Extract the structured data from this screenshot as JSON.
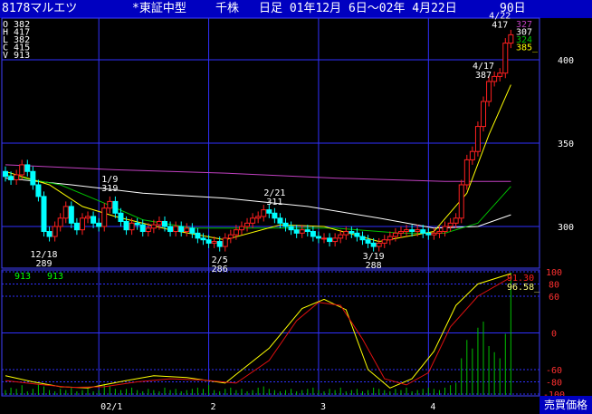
{
  "header": {
    "code_name": "8178マルエツ",
    "market": "*東証中型",
    "board": "千株",
    "period": "日足 01年12月 6日～02年 4月22日",
    "days": "90日"
  },
  "ohlcv": {
    "O": "382",
    "H": "417",
    "L": "382",
    "C": "415",
    "V": "913"
  },
  "ma_values": [
    {
      "value": "327",
      "color": "#c040c0"
    },
    {
      "value": "307",
      "color": "#ffffff"
    },
    {
      "value": "324",
      "color": "#00c000"
    },
    {
      "value": "385_",
      "color": "#ffff00"
    }
  ],
  "volume_label": {
    "a": "913",
    "b": "913"
  },
  "osc_values": [
    {
      "value": "91.30",
      "color": "#ff2020"
    },
    {
      "value": "96.58_",
      "color": "#ffff80"
    }
  ],
  "button_label": "売買価格",
  "chart_data": {
    "type": "candlestick",
    "price_axis": {
      "ticks": [
        300,
        350,
        400
      ],
      "ylim": [
        275,
        425
      ]
    },
    "osc_axis": {
      "ticks": [
        100,
        80,
        60,
        0,
        -60,
        -80,
        -100
      ],
      "ylim": [
        -100,
        100
      ]
    },
    "x_labels": [
      {
        "label": "02/1",
        "index": 17
      },
      {
        "label": "2",
        "index": 37
      },
      {
        "label": "3",
        "index": 57
      },
      {
        "label": "4",
        "index": 77
      }
    ],
    "annotations": [
      {
        "date": "12/18",
        "value": "289",
        "index": 7,
        "pos": "below"
      },
      {
        "date": "1/9",
        "value": "319",
        "index": 19,
        "pos": "above"
      },
      {
        "date": "2/5",
        "value": "286",
        "index": 39,
        "pos": "below"
      },
      {
        "date": "2/21",
        "value": "311",
        "index": 49,
        "pos": "above"
      },
      {
        "date": "3/19",
        "value": "288",
        "index": 67,
        "pos": "below"
      },
      {
        "date": "4/17",
        "value": "387",
        "index": 87,
        "pos": "above"
      },
      {
        "date": "4/22",
        "value": "417",
        "index": 90,
        "pos": "above"
      }
    ],
    "closes": [
      330,
      328,
      331,
      337,
      333,
      325,
      318,
      297,
      294,
      300,
      305,
      312,
      302,
      298,
      305,
      306,
      302,
      300,
      311,
      315,
      308,
      303,
      298,
      302,
      301,
      297,
      299,
      301,
      303,
      300,
      297,
      300,
      297,
      299,
      296,
      293,
      292,
      290,
      291,
      288,
      293,
      295,
      298,
      300,
      302,
      305,
      306,
      310,
      308,
      305,
      302,
      300,
      298,
      296,
      298,
      297,
      294,
      293,
      293,
      291,
      293,
      295,
      297,
      296,
      294,
      292,
      290,
      288,
      290,
      292,
      294,
      296,
      297,
      298,
      297,
      298,
      296,
      295,
      296,
      297,
      300,
      302,
      305,
      325,
      340,
      345,
      360,
      375,
      387,
      390,
      392,
      410,
      415
    ],
    "ma_series": [
      {
        "color": "#c040c0",
        "points": [
          [
            0,
            337
          ],
          [
            20,
            334
          ],
          [
            40,
            332
          ],
          [
            60,
            329
          ],
          [
            80,
            327
          ],
          [
            92,
            327
          ]
        ]
      },
      {
        "color": "#ffffff",
        "points": [
          [
            0,
            329
          ],
          [
            12,
            325
          ],
          [
            25,
            320
          ],
          [
            40,
            317
          ],
          [
            55,
            312
          ],
          [
            68,
            305
          ],
          [
            78,
            299
          ],
          [
            86,
            300
          ],
          [
            92,
            307
          ]
        ]
      },
      {
        "color": "#00c000",
        "points": [
          [
            0,
            331
          ],
          [
            10,
            325
          ],
          [
            18,
            314
          ],
          [
            25,
            304
          ],
          [
            34,
            299
          ],
          [
            48,
            299
          ],
          [
            60,
            299
          ],
          [
            72,
            296
          ],
          [
            80,
            296
          ],
          [
            86,
            302
          ],
          [
            92,
            324
          ]
        ]
      },
      {
        "color": "#ffff00",
        "points": [
          [
            0,
            333
          ],
          [
            8,
            325
          ],
          [
            14,
            312
          ],
          [
            20,
            306
          ],
          [
            30,
            298
          ],
          [
            40,
            292
          ],
          [
            50,
            301
          ],
          [
            58,
            300
          ],
          [
            68,
            291
          ],
          [
            78,
            297
          ],
          [
            84,
            320
          ],
          [
            88,
            355
          ],
          [
            92,
            385
          ]
        ]
      }
    ],
    "osc_series": [
      {
        "color": "#ffff00",
        "points": [
          [
            0,
            -70
          ],
          [
            5,
            -80
          ],
          [
            10,
            -88
          ],
          [
            15,
            -90
          ],
          [
            22,
            -78
          ],
          [
            27,
            -70
          ],
          [
            33,
            -73
          ],
          [
            40,
            -82
          ],
          [
            48,
            -25
          ],
          [
            54,
            40
          ],
          [
            58,
            55
          ],
          [
            62,
            38
          ],
          [
            66,
            -60
          ],
          [
            70,
            -90
          ],
          [
            74,
            -75
          ],
          [
            78,
            -30
          ],
          [
            82,
            45
          ],
          [
            86,
            80
          ],
          [
            92,
            97
          ]
        ]
      },
      {
        "color": "#e01010",
        "points": [
          [
            0,
            -78
          ],
          [
            6,
            -84
          ],
          [
            12,
            -89
          ],
          [
            18,
            -88
          ],
          [
            24,
            -80
          ],
          [
            30,
            -75
          ],
          [
            36,
            -77
          ],
          [
            42,
            -82
          ],
          [
            48,
            -45
          ],
          [
            53,
            20
          ],
          [
            57,
            50
          ],
          [
            61,
            45
          ],
          [
            65,
            -10
          ],
          [
            69,
            -75
          ],
          [
            73,
            -85
          ],
          [
            77,
            -65
          ],
          [
            81,
            10
          ],
          [
            86,
            60
          ],
          [
            92,
            91
          ]
        ]
      }
    ],
    "volumes": [
      4,
      6,
      5,
      8,
      3,
      5,
      9,
      7,
      4,
      3,
      5,
      4,
      6,
      3,
      4,
      5,
      3,
      4,
      9,
      7,
      5,
      4,
      5,
      6,
      4,
      3,
      5,
      4,
      3,
      6,
      4,
      5,
      3,
      4,
      5,
      6,
      5,
      8,
      4,
      3,
      5,
      6,
      4,
      5,
      3,
      4,
      6,
      7,
      5,
      4,
      3,
      4,
      5,
      3,
      4,
      5,
      6,
      4,
      3,
      5,
      4,
      6,
      3,
      4,
      5,
      3,
      4,
      6,
      5,
      4,
      3,
      5,
      4,
      6,
      3,
      4,
      5,
      6,
      5,
      4,
      6,
      8,
      10,
      30,
      45,
      38,
      55,
      60,
      40,
      35,
      30,
      50,
      100
    ]
  }
}
